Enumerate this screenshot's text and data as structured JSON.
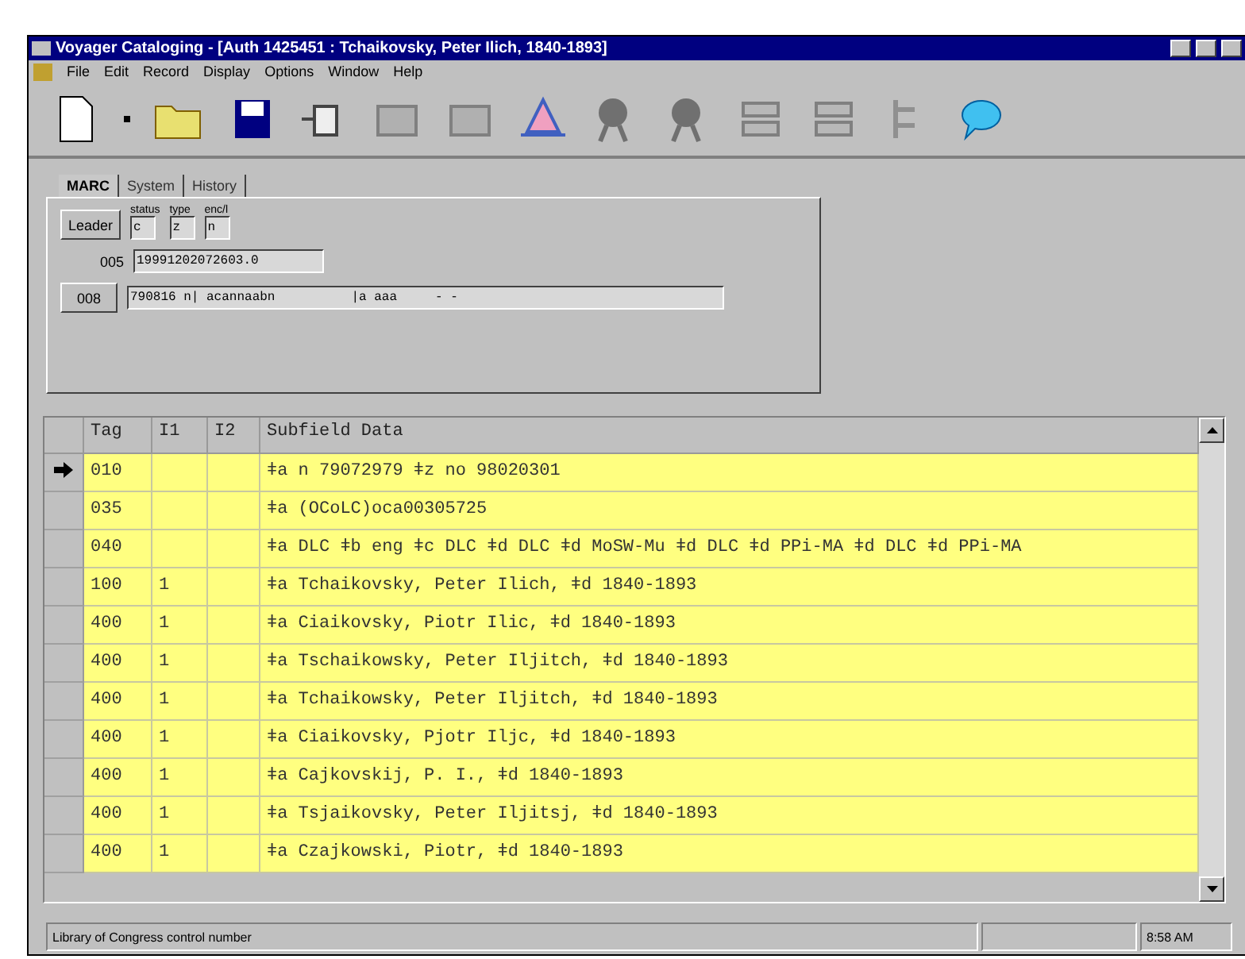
{
  "window": {
    "title": "Voyager Cataloging - [Auth 1425451 : Tchaikovsky, Peter Ilich, 1840-1893]"
  },
  "menu": [
    "File",
    "Edit",
    "Record",
    "Display",
    "Options",
    "Window",
    "Help"
  ],
  "tabs": [
    {
      "label": "MARC",
      "selected": true
    },
    {
      "label": "System",
      "selected": false
    },
    {
      "label": "History",
      "selected": false
    }
  ],
  "leader": {
    "button": "Leader",
    "fields": [
      {
        "label": "status",
        "value": "c"
      },
      {
        "label": "type",
        "value": "z"
      },
      {
        "label": "enc/l",
        "value": "n"
      }
    ]
  },
  "field_005": {
    "label": "005",
    "value": "19991202072603.0"
  },
  "field_008": {
    "button": "008",
    "value": "790816 n| acannaabn          |a aaa     - -"
  },
  "table": {
    "columns": [
      "Tag",
      "I1",
      "I2",
      "Subfield Data"
    ],
    "rows": [
      {
        "tag": "010",
        "i1": "",
        "i2": "",
        "data": "ǂa n  79072979  ǂz no 98020301",
        "selected": true
      },
      {
        "tag": "035",
        "i1": "",
        "i2": "",
        "data": "ǂa (OCoLC)oca00305725",
        "selected": false
      },
      {
        "tag": "040",
        "i1": "",
        "i2": "",
        "data": "ǂa DLC ǂb eng ǂc DLC ǂd DLC ǂd MoSW-Mu ǂd DLC ǂd PPi-MA ǂd DLC ǂd PPi-MA",
        "selected": false
      },
      {
        "tag": "100",
        "i1": "1",
        "i2": "",
        "data": "ǂa Tchaikovsky, Peter Ilich, ǂd 1840-1893",
        "selected": false
      },
      {
        "tag": "400",
        "i1": "1",
        "i2": "",
        "data": "ǂa Ciaikovsky, Piotr Ilic, ǂd 1840-1893",
        "selected": false
      },
      {
        "tag": "400",
        "i1": "1",
        "i2": "",
        "data": "ǂa Tschaikowsky, Peter Iljitch, ǂd 1840-1893",
        "selected": false
      },
      {
        "tag": "400",
        "i1": "1",
        "i2": "",
        "data": "ǂa Tchaikowsky, Peter Iljitch, ǂd 1840-1893",
        "selected": false
      },
      {
        "tag": "400",
        "i1": "1",
        "i2": "",
        "data": "ǂa Ciaikovsky, Pjotr Iljc, ǂd 1840-1893",
        "selected": false
      },
      {
        "tag": "400",
        "i1": "1",
        "i2": "",
        "data": "ǂa Cajkovskij, P. I., ǂd 1840-1893",
        "selected": false
      },
      {
        "tag": "400",
        "i1": "1",
        "i2": "",
        "data": "ǂa Tsjaikovsky, Peter Iljitsj, ǂd 1840-1893",
        "selected": false
      },
      {
        "tag": "400",
        "i1": "1",
        "i2": "",
        "data": "ǂa Czajkowski, Piotr, ǂd 1840-1893",
        "selected": false
      }
    ]
  },
  "status_bar": {
    "message": "Library of Congress control number",
    "time": "8:58 AM"
  }
}
